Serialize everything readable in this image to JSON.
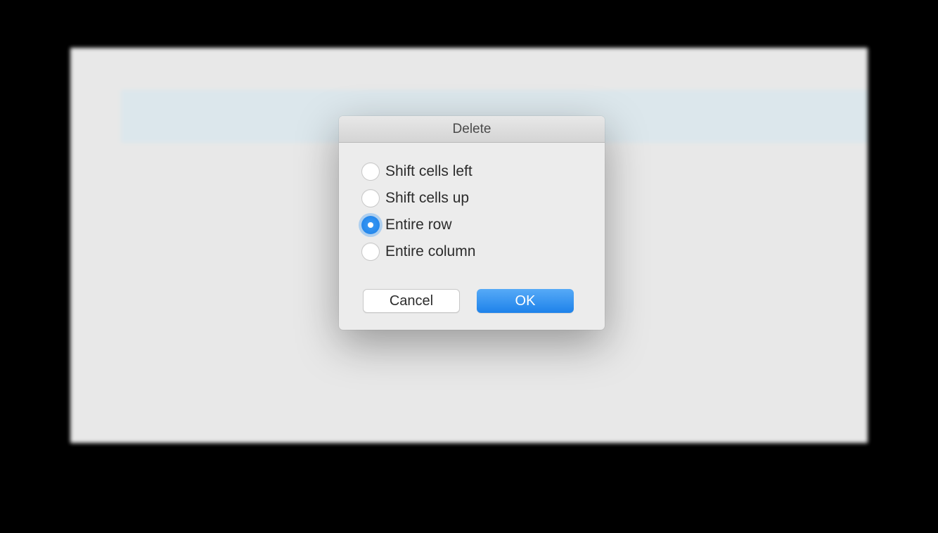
{
  "dialog": {
    "title": "Delete",
    "options": [
      {
        "label": "Shift cells left",
        "selected": false
      },
      {
        "label": "Shift cells up",
        "selected": false
      },
      {
        "label": "Entire row",
        "selected": true
      },
      {
        "label": "Entire column",
        "selected": false
      }
    ],
    "cancel_label": "Cancel",
    "ok_label": "OK"
  }
}
